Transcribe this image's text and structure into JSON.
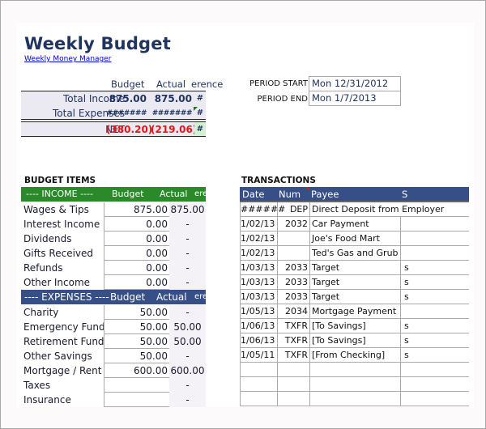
{
  "header": {
    "title": "Weekly Budget",
    "subtitle_link": "Weekly Money Manager"
  },
  "summary": {
    "col_budget": "Budget",
    "col_actual": "Actual",
    "col_difference": "erence",
    "rows": [
      {
        "label": "Total Income",
        "budget": "875.00",
        "actual": "875.00",
        "difference": "#"
      },
      {
        "label": "Total Expenses",
        "budget": "#######",
        "actual": "#######",
        "difference": "#"
      },
      {
        "label": "NET",
        "budget": "(380.20)",
        "actual": "(219.06)",
        "difference": "#"
      }
    ]
  },
  "period": {
    "start_label": "PERIOD START",
    "start_value": "Mon 12/31/2012",
    "end_label": "PERIOD END",
    "end_value": "Mon 1/7/2013"
  },
  "budget_items": {
    "section_title": "BUDGET ITEMS",
    "income_header": {
      "label": "---- INCOME ----",
      "budget": "Budget",
      "actual": "Actual",
      "difference": "ere"
    },
    "income": [
      {
        "name": "Wages & Tips",
        "budget": "875.00",
        "actual": "875.00"
      },
      {
        "name": "Interest Income",
        "budget": "0.00",
        "actual": "-"
      },
      {
        "name": "Dividends",
        "budget": "0.00",
        "actual": "-"
      },
      {
        "name": "Gifts Received",
        "budget": "0.00",
        "actual": "-"
      },
      {
        "name": "Refunds",
        "budget": "0.00",
        "actual": "-"
      },
      {
        "name": "Other Income",
        "budget": "0.00",
        "actual": "-"
      }
    ],
    "expenses_header": {
      "label": "---- EXPENSES ----",
      "budget": "Budget",
      "actual": "Actual",
      "difference": "ere"
    },
    "expenses": [
      {
        "name": "Charity",
        "budget": "50.00",
        "actual": "-"
      },
      {
        "name": "Emergency Fund",
        "budget": "50.00",
        "actual": "50.00"
      },
      {
        "name": "Retirement Fund",
        "budget": "50.00",
        "actual": "50.00"
      },
      {
        "name": "Other Savings",
        "budget": "50.00",
        "actual": "-"
      },
      {
        "name": "Mortgage / Rent",
        "budget": "600.00",
        "actual": "600.00"
      },
      {
        "name": "Taxes",
        "budget": "",
        "actual": "-"
      },
      {
        "name": "Insurance",
        "budget": "",
        "actual": "-"
      }
    ]
  },
  "transactions": {
    "section_title": "TRANSACTIONS",
    "columns": {
      "date": "Date",
      "num": "Num",
      "payee": "Payee",
      "s": "S"
    },
    "rows": [
      {
        "date": "######",
        "num": "DEP",
        "payee": "Direct Deposit from Employer",
        "s": ""
      },
      {
        "date": "1/02/13",
        "num": "2032",
        "payee": "Car Payment",
        "s": ""
      },
      {
        "date": "1/02/13",
        "num": "",
        "payee": "Joe's Food Mart",
        "s": ""
      },
      {
        "date": "1/02/13",
        "num": "",
        "payee": "Ted's Gas and Grub",
        "s": ""
      },
      {
        "date": "1/03/13",
        "num": "2033",
        "payee": "Target",
        "s": "s"
      },
      {
        "date": "1/03/13",
        "num": "2033",
        "payee": "Target",
        "s": "s"
      },
      {
        "date": "1/03/13",
        "num": "2033",
        "payee": "Target",
        "s": "s"
      },
      {
        "date": "1/05/13",
        "num": "2034",
        "payee": "Mortgage Payment",
        "s": ""
      },
      {
        "date": "1/06/13",
        "num": "TXFR",
        "payee": "[To Savings]",
        "s": "s"
      },
      {
        "date": "1/06/13",
        "num": "TXFR",
        "payee": "[To Savings]",
        "s": "s"
      },
      {
        "date": "1/05/11",
        "num": "TXFR",
        "payee": "[From Checking]",
        "s": "s"
      },
      {
        "date": "",
        "num": "",
        "payee": "",
        "s": ""
      },
      {
        "date": "",
        "num": "",
        "payee": "",
        "s": ""
      },
      {
        "date": "",
        "num": "",
        "payee": "",
        "s": ""
      }
    ]
  },
  "colors": {
    "title": "#1f3460",
    "income_band": "#2a8a2a",
    "expenses_band": "#374f87",
    "negative": "#e01818",
    "summary_bg": "#ebe9f2"
  }
}
